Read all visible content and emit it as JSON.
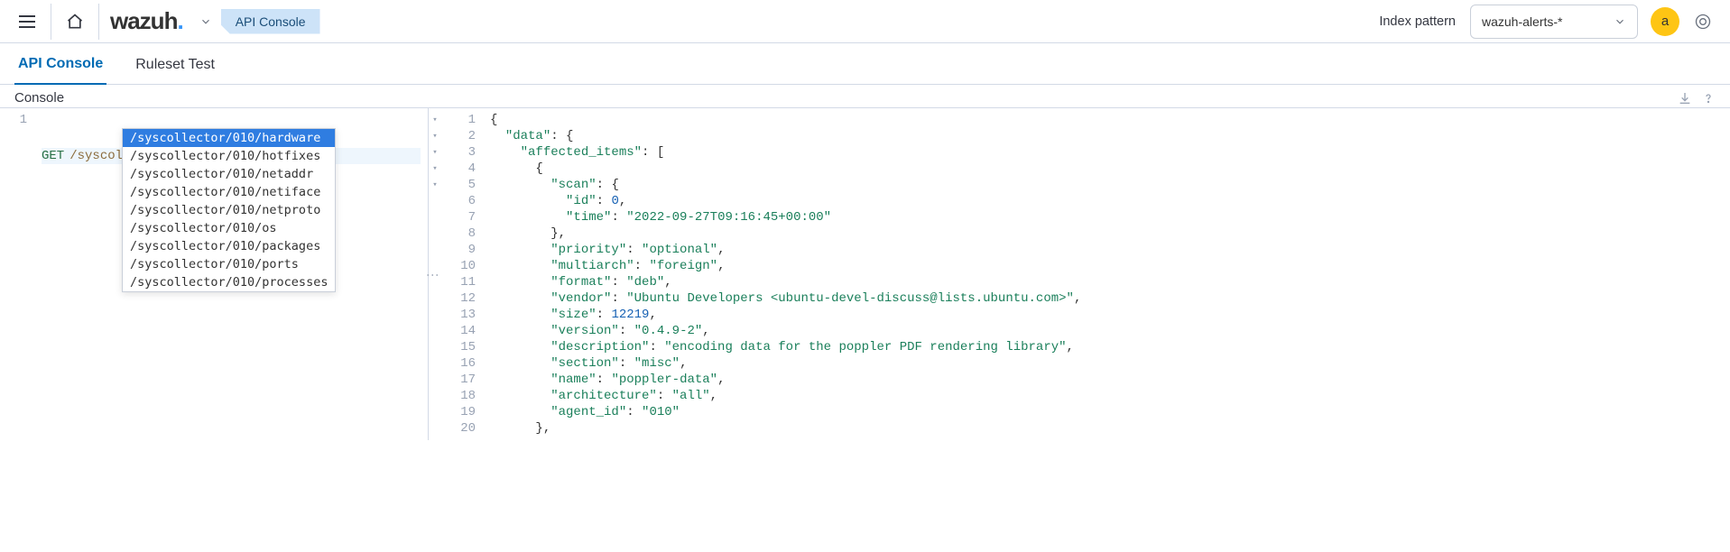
{
  "header": {
    "logo_main": "wazuh",
    "logo_dot": ".",
    "breadcrumb": "API Console",
    "index_pattern_label": "Index pattern",
    "index_pattern_value": "wazuh-alerts-*",
    "avatar_letter": "a"
  },
  "tabs": {
    "active": "API Console",
    "inactive": "Ruleset Test"
  },
  "console": {
    "title": "Console",
    "request_method": "GET",
    "request_path": "/syscollector/010/",
    "request_line_no": "1"
  },
  "autocomplete": {
    "items": [
      "/syscollector/010/hardware",
      "/syscollector/010/hotfixes",
      "/syscollector/010/netaddr",
      "/syscollector/010/netiface",
      "/syscollector/010/netproto",
      "/syscollector/010/os",
      "/syscollector/010/packages",
      "/syscollector/010/ports",
      "/syscollector/010/processes"
    ],
    "selected_index": 0
  },
  "response": {
    "line_numbers": [
      "1",
      "2",
      "3",
      "4",
      "5",
      "6",
      "7",
      "8",
      "9",
      "10",
      "11",
      "12",
      "13",
      "14",
      "15",
      "16",
      "17",
      "18",
      "19",
      "20"
    ],
    "fold_rows": [
      0,
      1,
      2,
      3,
      4
    ],
    "lines": [
      {
        "indent": 0,
        "type": "open",
        "text": "{"
      },
      {
        "indent": 1,
        "type": "keyopen",
        "key": "data",
        "text": ": {"
      },
      {
        "indent": 2,
        "type": "keyopen",
        "key": "affected_items",
        "text": ": ["
      },
      {
        "indent": 3,
        "type": "open",
        "text": "{"
      },
      {
        "indent": 4,
        "type": "keyopen",
        "key": "scan",
        "text": ": {"
      },
      {
        "indent": 5,
        "type": "kv",
        "key": "id",
        "valnum": "0",
        "comma": true
      },
      {
        "indent": 5,
        "type": "kv",
        "key": "time",
        "valstr": "2022-09-27T09:16:45+00:00"
      },
      {
        "indent": 4,
        "type": "close",
        "text": "},"
      },
      {
        "indent": 4,
        "type": "kv",
        "key": "priority",
        "valstr": "optional",
        "comma": true
      },
      {
        "indent": 4,
        "type": "kv",
        "key": "multiarch",
        "valstr": "foreign",
        "comma": true
      },
      {
        "indent": 4,
        "type": "kv",
        "key": "format",
        "valstr": "deb",
        "comma": true
      },
      {
        "indent": 4,
        "type": "kv",
        "key": "vendor",
        "valstr": "Ubuntu Developers <ubuntu-devel-discuss@lists.ubuntu.com>",
        "comma": true
      },
      {
        "indent": 4,
        "type": "kv",
        "key": "size",
        "valnum": "12219",
        "comma": true
      },
      {
        "indent": 4,
        "type": "kv",
        "key": "version",
        "valstr": "0.4.9-2",
        "comma": true
      },
      {
        "indent": 4,
        "type": "kv",
        "key": "description",
        "valstr": "encoding data for the poppler PDF rendering library",
        "comma": true
      },
      {
        "indent": 4,
        "type": "kv",
        "key": "section",
        "valstr": "misc",
        "comma": true
      },
      {
        "indent": 4,
        "type": "kv",
        "key": "name",
        "valstr": "poppler-data",
        "comma": true
      },
      {
        "indent": 4,
        "type": "kv",
        "key": "architecture",
        "valstr": "all",
        "comma": true
      },
      {
        "indent": 4,
        "type": "kv",
        "key": "agent_id",
        "valstr": "010"
      },
      {
        "indent": 3,
        "type": "close",
        "text": "},"
      }
    ]
  }
}
